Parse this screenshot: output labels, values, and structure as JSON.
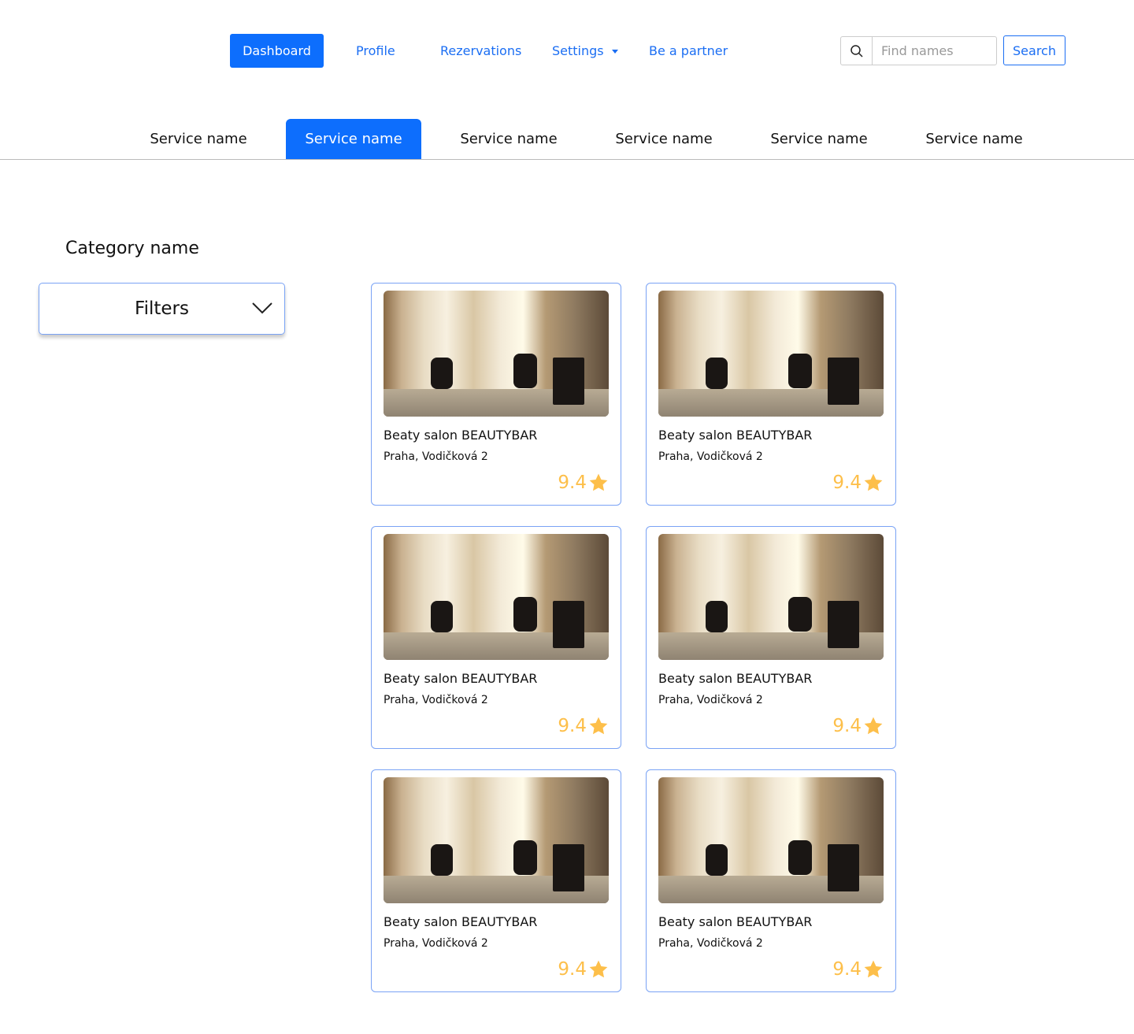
{
  "nav": {
    "items": [
      "Dashboard",
      "Profile",
      "Rezervations",
      "Settings",
      "Be a partner"
    ],
    "active": "Dashboard"
  },
  "search": {
    "placeholder": "Find names",
    "button": "Search"
  },
  "tabs": [
    "Service name",
    "Service name",
    "Service name",
    "Service name",
    "Service name",
    "Service name"
  ],
  "active_tab_index": 1,
  "category": "Category name",
  "filters_label": "Filters",
  "cards": [
    {
      "title": "Beaty salon BEAUTYBAR",
      "address": "Praha, Vodičková 2",
      "rating": "9.4"
    },
    {
      "title": "Beaty salon BEAUTYBAR",
      "address": "Praha, Vodičková 2",
      "rating": "9.4"
    },
    {
      "title": "Beaty salon BEAUTYBAR",
      "address": "Praha, Vodičková 2",
      "rating": "9.4"
    },
    {
      "title": "Beaty salon BEAUTYBAR",
      "address": "Praha, Vodičková 2",
      "rating": "9.4"
    },
    {
      "title": "Beaty salon BEAUTYBAR",
      "address": "Praha, Vodičková 2",
      "rating": "9.4"
    },
    {
      "title": "Beaty salon BEAUTYBAR",
      "address": "Praha, Vodičková 2",
      "rating": "9.4"
    }
  ],
  "colors": {
    "accent": "#0d6efd",
    "card_border": "#7aa3f5",
    "rating": "#fdbf4a"
  }
}
